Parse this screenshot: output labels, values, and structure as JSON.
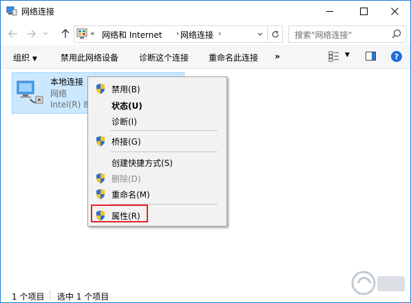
{
  "window": {
    "title": "网络连接",
    "controls": {
      "minimize": "minimize",
      "maximize": "maximize",
      "close": "close"
    }
  },
  "address": {
    "overflow": "«",
    "crumbs": [
      "网络和 Internet",
      "网络连接"
    ],
    "separator": "›"
  },
  "search": {
    "placeholder": "搜索\"网络连接\""
  },
  "toolbar": {
    "organize": "组织",
    "disable_device": "禁用此网络设备",
    "diagnose": "诊断这个连接",
    "rename": "重命名此连接",
    "more": "»"
  },
  "connection": {
    "name": "本地连接",
    "type": "网络",
    "adapter": "Intel(R) 82"
  },
  "context_menu": {
    "items": [
      {
        "label": "禁用(B)",
        "shield": true
      },
      {
        "label": "状态(U)",
        "bold": true
      },
      {
        "label": "诊断(I)"
      },
      {
        "label": "桥接(G)",
        "shield": true
      },
      {
        "label": "创建快捷方式(S)"
      },
      {
        "label": "删除(D)",
        "shield": true,
        "disabled": true
      },
      {
        "label": "重命名(M)",
        "shield": true
      },
      {
        "label": "属性(R)",
        "shield": true,
        "highlighted": true
      }
    ]
  },
  "status": {
    "item_count": "1 个项目",
    "selected": "选中 1 个项目"
  },
  "colors": {
    "accent": "#1e6fd9",
    "selection": "#cce8ff",
    "highlight_box": "#e52421"
  }
}
